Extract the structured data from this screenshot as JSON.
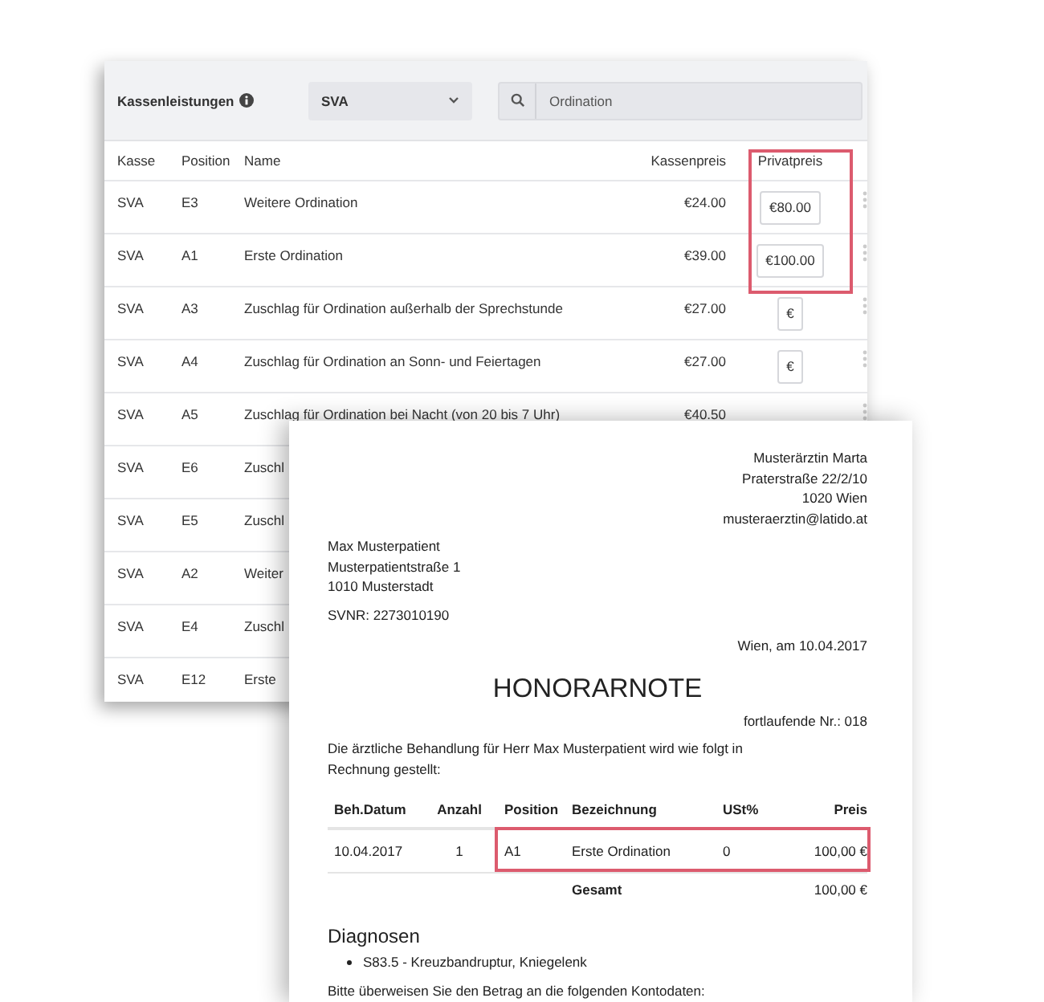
{
  "app": {
    "title": "Kassenleistungen",
    "insurer_select": {
      "value": "SVA"
    },
    "search": {
      "value": "Ordination"
    },
    "table": {
      "columns": [
        {
          "label": "Kasse",
          "highlighted": false
        },
        {
          "label": "Position",
          "highlighted": false
        },
        {
          "label": "Name",
          "highlighted": false
        },
        {
          "label": "Kassenpreis",
          "highlighted": false
        },
        {
          "label": "Privatpreis",
          "highlighted": true
        }
      ],
      "rows": [
        {
          "kasse": "SVA",
          "position": "E3",
          "name": "Weitere Ordination",
          "kassenpreis": "€24.00",
          "privatpreis": "€80.00"
        },
        {
          "kasse": "SVA",
          "position": "A1",
          "name": "Erste Ordination",
          "kassenpreis": "€39.00",
          "privatpreis": "€100.00"
        },
        {
          "kasse": "SVA",
          "position": "A3",
          "name": "Zuschlag für Ordination außerhalb der Sprechstunde",
          "kassenpreis": "€27.00",
          "privatpreis": "€"
        },
        {
          "kasse": "SVA",
          "position": "A4",
          "name": "Zuschlag für Ordination an Sonn- und Feiertagen",
          "kassenpreis": "€27.00",
          "privatpreis": "€"
        },
        {
          "kasse": "SVA",
          "position": "A5",
          "name": "Zuschlag für Ordination bei Nacht (von 20 bis 7 Uhr)",
          "kassenpreis": "€40.50"
        },
        {
          "kasse": "SVA",
          "position": "E6",
          "name": "Zuschl"
        },
        {
          "kasse": "SVA",
          "position": "E5",
          "name": "Zuschl"
        },
        {
          "kasse": "SVA",
          "position": "A2",
          "name": "Weiter"
        },
        {
          "kasse": "SVA",
          "position": "E4",
          "name": "Zuschl"
        },
        {
          "kasse": "SVA",
          "position": "E12",
          "name": "Erste"
        }
      ]
    }
  },
  "invoice": {
    "sender": [
      "Musterärztin Marta",
      "Praterstraße 22/2/10",
      "1020 Wien",
      "musteraerztin@latido.at"
    ],
    "recipient": [
      "Max Musterpatient",
      "Musterpatientstraße 1",
      "1010 Musterstadt"
    ],
    "svnr": "SVNR: 2273010190",
    "date": "Wien, am 10.04.2017",
    "title": "HONORARNOTE",
    "number": "fortlaufende Nr.: 018",
    "intro": "Die ärztliche Behandlung für Herr Max Musterpatient wird wie folgt in Rechnung gestellt:",
    "table": {
      "columns": [
        "Beh.Datum",
        "Anzahl",
        "Position",
        "Bezeichnung",
        "USt%",
        "Preis"
      ],
      "rows": [
        {
          "cells": [
            "10.04.2017",
            "1",
            "A1",
            "Erste Ordination",
            "0",
            "100,00 €"
          ],
          "highlighted": true
        }
      ],
      "total": {
        "label": "Gesamt",
        "value": "100,00 €"
      }
    },
    "diagnoses_title": "Diagnosen",
    "diagnoses": [
      "S83.5 - Kreuzbandruptur, Kniegelenk"
    ],
    "closing": "Bitte überweisen Sie den Betrag an die folgenden Kontodaten:"
  }
}
